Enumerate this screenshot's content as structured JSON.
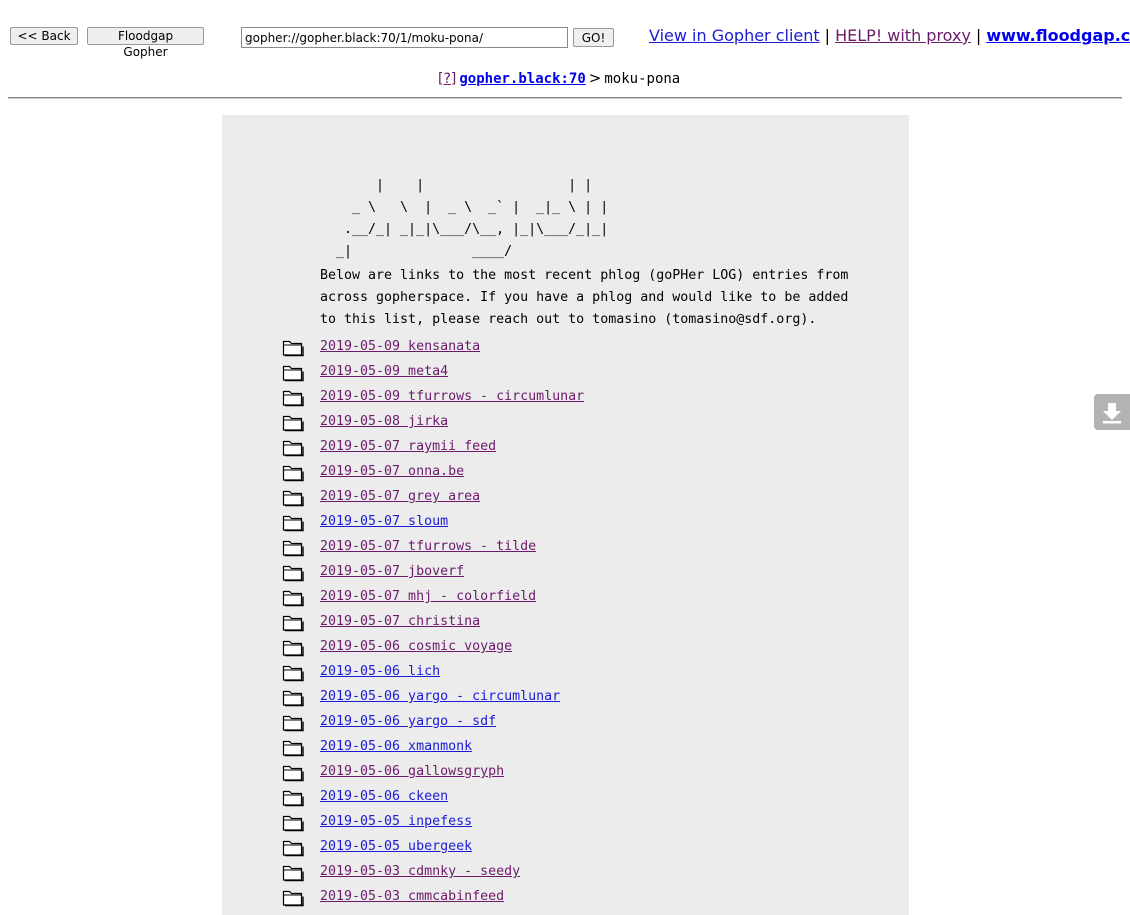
{
  "toolbar": {
    "back_label": "<< Back",
    "floodgap_label": "Floodgap Gopher",
    "url_value": "gopher://gopher.black:70/1/moku-pona/",
    "go_label": "GO!"
  },
  "top_links": {
    "view_client": "View in Gopher client",
    "help_proxy": "HELP! with proxy",
    "floodgap_site": "www.floodgap.com",
    "separator": "|"
  },
  "breadcrumb": {
    "help": "[?]",
    "host": "gopher.black:70",
    "separator": ">",
    "current": "moku-pona"
  },
  "ascii_art": "       |    |                  | |\n    _ \\   \\  |  _ \\  _` |  _|_ \\ | |\n   .__/_| _|_|\\___/\\__, |_|\\___/_|_|\n  _|               ____/",
  "intro_text": "Below are links to the most recent phlog (goPHer LOG) entries from\nacross gopherspace. If you have a phlog and would like to be added\nto this list, please reach out to tomasino (tomasino@sdf.org).",
  "entries": [
    {
      "label": "2019-05-09 kensanata",
      "visited": true
    },
    {
      "label": "2019-05-09 meta4",
      "visited": true
    },
    {
      "label": "2019-05-09 tfurrows - circumlunar",
      "visited": true
    },
    {
      "label": "2019-05-08 jirka",
      "visited": true
    },
    {
      "label": "2019-05-07 raymii feed",
      "visited": true
    },
    {
      "label": "2019-05-07 onna.be",
      "visited": true
    },
    {
      "label": "2019-05-07 grey area",
      "visited": true
    },
    {
      "label": "2019-05-07 sloum",
      "visited": false
    },
    {
      "label": "2019-05-07 tfurrows - tilde",
      "visited": true
    },
    {
      "label": "2019-05-07 jboverf",
      "visited": true
    },
    {
      "label": "2019-05-07 mhj - colorfield",
      "visited": true
    },
    {
      "label": "2019-05-07 christina",
      "visited": true
    },
    {
      "label": "2019-05-06 cosmic voyage",
      "visited": true
    },
    {
      "label": "2019-05-06 lich",
      "visited": false
    },
    {
      "label": "2019-05-06 yargo - circumlunar",
      "visited": false
    },
    {
      "label": "2019-05-06 yargo - sdf",
      "visited": false
    },
    {
      "label": "2019-05-06 xmanmonk",
      "visited": false
    },
    {
      "label": "2019-05-06 gallowsgryph",
      "visited": true
    },
    {
      "label": "2019-05-06 ckeen",
      "visited": false
    },
    {
      "label": "2019-05-05 inpefess",
      "visited": false
    },
    {
      "label": "2019-05-05 ubergeek",
      "visited": false
    },
    {
      "label": "2019-05-03 cdmnky - seedy",
      "visited": true
    },
    {
      "label": "2019-05-03 cmmcabinfeed",
      "visited": true
    }
  ],
  "icons": {
    "entry_icon": "folder-icon",
    "download_icon": "download-icon"
  },
  "colors": {
    "visited_link": "#6c1b6b",
    "unvisited_link": "#1b1bd6",
    "panel_bg": "#ececec"
  }
}
